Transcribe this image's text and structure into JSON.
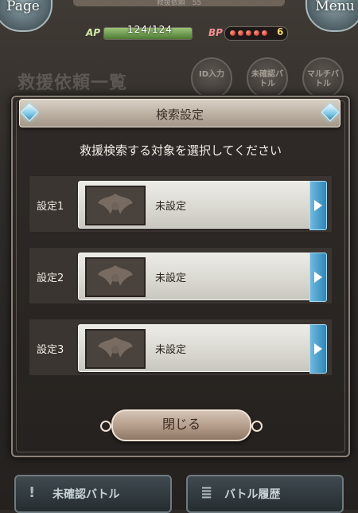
{
  "hud": {
    "left_button_label": "Page",
    "right_button_label": "Menu",
    "top_strip_text": "救援依頼　55",
    "ap_label": "AP",
    "ap_value": "124/124",
    "ap_fraction": 1.0,
    "bp_label": "BP",
    "bp_value": "6",
    "bp_dots": 5
  },
  "background": {
    "title": "救援依頼一覧",
    "buttons": [
      {
        "label": "ID入力"
      },
      {
        "label": "未確認バトル"
      },
      {
        "label": "マルチバトル"
      }
    ],
    "bottom_buttons": [
      {
        "icon": "exclamation-icon",
        "label": "未確認バトル"
      },
      {
        "icon": "scroll-icon",
        "label": "バトル履歴"
      }
    ]
  },
  "modal": {
    "title": "検索設定",
    "subtitle": "救援検索する対象を選択してください",
    "rows": [
      {
        "label": "設定1",
        "value": "未設定"
      },
      {
        "label": "設定2",
        "value": "未設定"
      },
      {
        "label": "設定3",
        "value": "未設定"
      }
    ],
    "close_label": "閉じる"
  },
  "colors": {
    "accent_blue": "#2f86b8",
    "ap_green": "#4d7a33",
    "bp_red": "#b0231a"
  }
}
